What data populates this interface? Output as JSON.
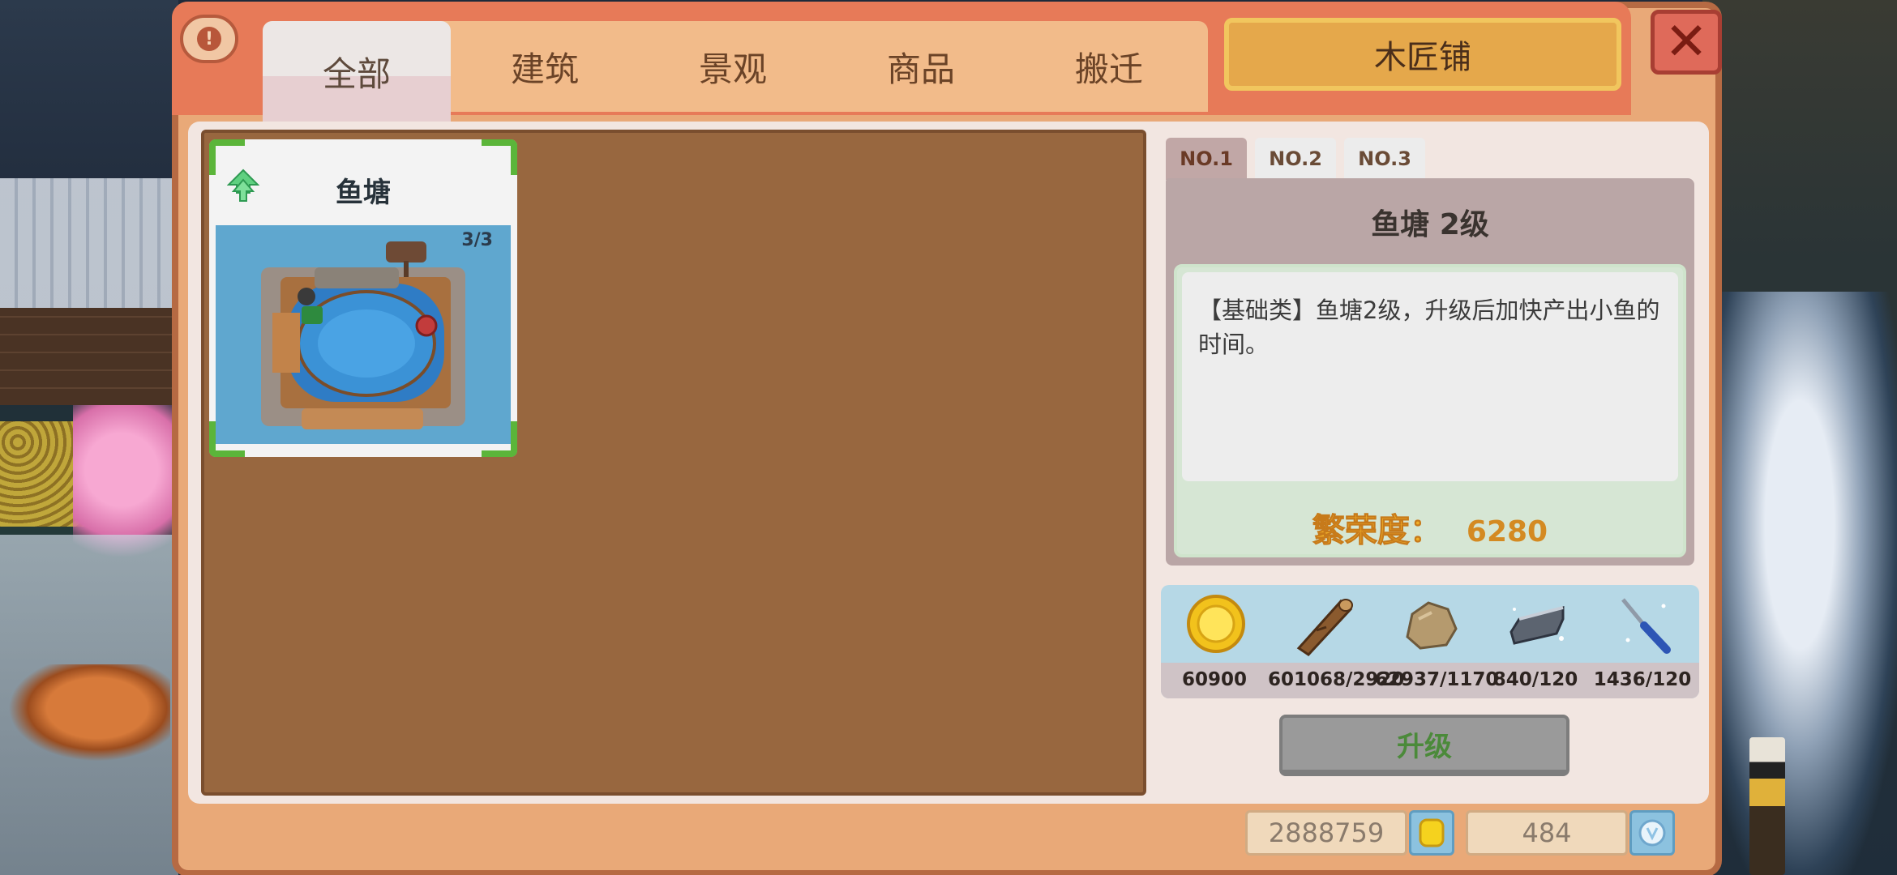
{
  "header": {
    "info_label": "!",
    "tabs": [
      {
        "label": "全部",
        "active": true
      },
      {
        "label": "建筑",
        "active": false
      },
      {
        "label": "景观",
        "active": false
      },
      {
        "label": "商品",
        "active": false
      },
      {
        "label": "搬迁",
        "active": false
      }
    ],
    "shop_title": "木匠铺",
    "close_label": "✕"
  },
  "items": [
    {
      "name": "鱼塘",
      "count": "3/3",
      "upgradable": true
    }
  ],
  "detail": {
    "slots": [
      "NO.1",
      "NO.2",
      "NO.3"
    ],
    "active_slot": "NO.1",
    "title": "鱼塘 2级",
    "description": "【基础类】鱼塘2级，升级后加快产出小鱼的时间。",
    "prosperity_label": "繁荣度：",
    "prosperity_value": "6280"
  },
  "resources": [
    {
      "icon": "gold-coin-icon",
      "amount": "60900"
    },
    {
      "icon": "wood-log-icon",
      "amount": "601068/2920"
    },
    {
      "icon": "stone-icon",
      "amount": "62937/1170"
    },
    {
      "icon": "iron-ingot-icon",
      "amount": "840/120"
    },
    {
      "icon": "screwdriver-icon",
      "amount": "1436/120"
    }
  ],
  "upgrade_label": "升级",
  "currency": {
    "coins": "2888759",
    "gems": "484"
  },
  "colors": {
    "frame": "#e9a978",
    "header": "#e77a58",
    "grid_bg": "#98673f",
    "accent_green": "#5bb53a",
    "prosperity": "#f0b02a"
  }
}
